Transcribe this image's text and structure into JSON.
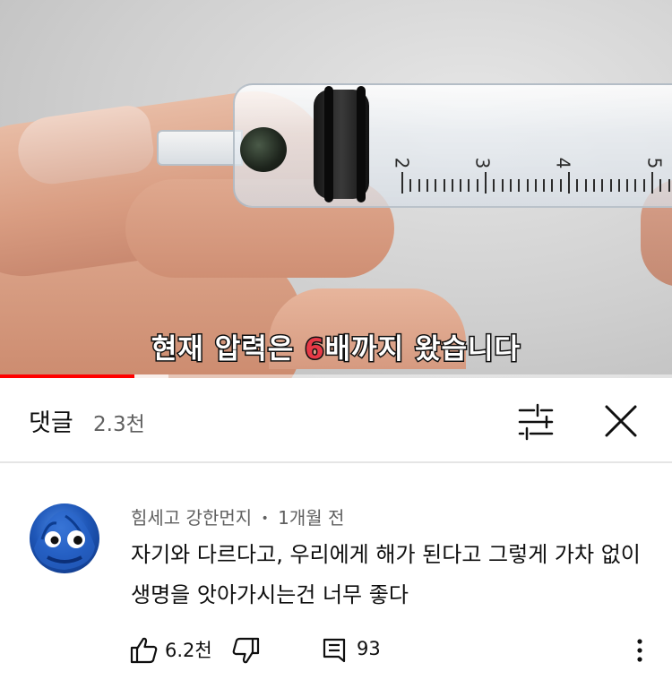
{
  "video": {
    "caption_before": "현재 압력은 ",
    "caption_highlight": "6",
    "caption_after": "배까지 왔습니다",
    "syringe_scale": [
      "2",
      "3",
      "4",
      "5"
    ],
    "progress": 0.2,
    "buffered": 0.25,
    "progress_color": "#ff0000",
    "highlight_color": "#e63946"
  },
  "comments_header": {
    "title": "댓글",
    "count": "2.3천",
    "filter_icon": "sliders-icon",
    "close_icon": "close-icon"
  },
  "comment": {
    "author": "힘세고 강한먼지",
    "separator": "•",
    "time": "1개월 전",
    "text": "자기와 다르다고, 우리에게 해가 된다고 그렇게 가차 없이 생명을 앗아가시는건 너무 좋다",
    "likes": "6.2천",
    "replies": "93",
    "avatar_icon": "blue-creature-avatar"
  },
  "colors": {
    "text_primary": "#0f0f0f",
    "text_secondary": "#606060",
    "divider": "#e5e5e5"
  }
}
